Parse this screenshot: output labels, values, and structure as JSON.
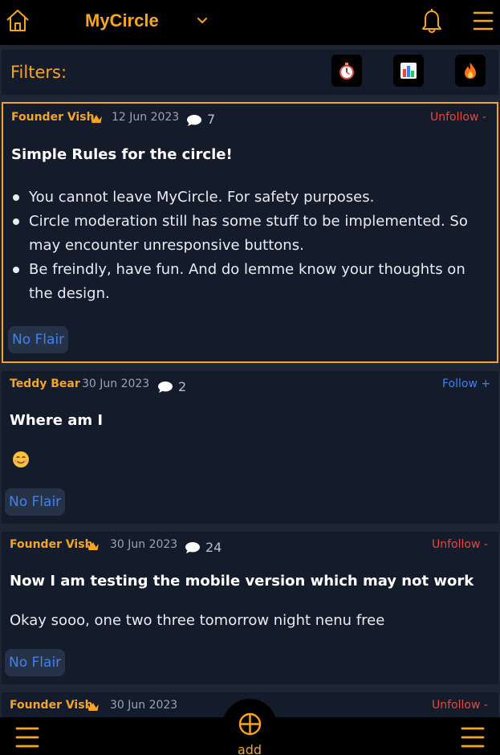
{
  "header": {
    "app_title": "MyCircle",
    "icons": [
      "home-icon",
      "chevron-down-icon",
      "bell-icon",
      "menu-icon"
    ]
  },
  "filters": {
    "label": "Filters:",
    "buttons": [
      "stopwatch-icon",
      "bar-chart-icon",
      "fire-icon"
    ]
  },
  "posts": [
    {
      "author": "Founder Vish",
      "founder_badge": "crown-icon",
      "date": "12 Jun 2023",
      "comments": "7",
      "follow": "Unfollow -",
      "title": "Simple Rules for the circle!",
      "rules": [
        "You cannot leave MyCircle. For safety purposes.",
        "Circle moderation still has some stuff to be implemented. So may encounter unresponsive buttons.",
        "Be freindly, have fun. And do lemme know your thoughts on the design."
      ],
      "flair": "No Flair"
    },
    {
      "author": "Teddy Bear",
      "date": "30 Jun 2023",
      "comments": "2",
      "follow": "Follow +",
      "title": "Where am I",
      "body_emoji": "smiling-face-emoji",
      "flair": "No Flair"
    },
    {
      "author": "Founder Vish",
      "founder_badge": "crown-icon",
      "date": "30 Jun 2023",
      "comments": "24",
      "follow": "Unfollow -",
      "title": "Now I am testing the mobile version which may not work",
      "body": "Okay sooo, one two three tomorrow night nenu free",
      "flair": "No Flair"
    },
    {
      "author": "Founder Vish",
      "founder_badge": "crown-icon",
      "date": "30 Jun 2023",
      "follow": "Unfollow -"
    }
  ],
  "bottom": {
    "add_post_label": "add post"
  },
  "colors": {
    "accent": "#f5a524",
    "unfollow": "#e8463f",
    "follow": "#3b82f6",
    "background": "#1e2633",
    "card": "#141b2b"
  }
}
